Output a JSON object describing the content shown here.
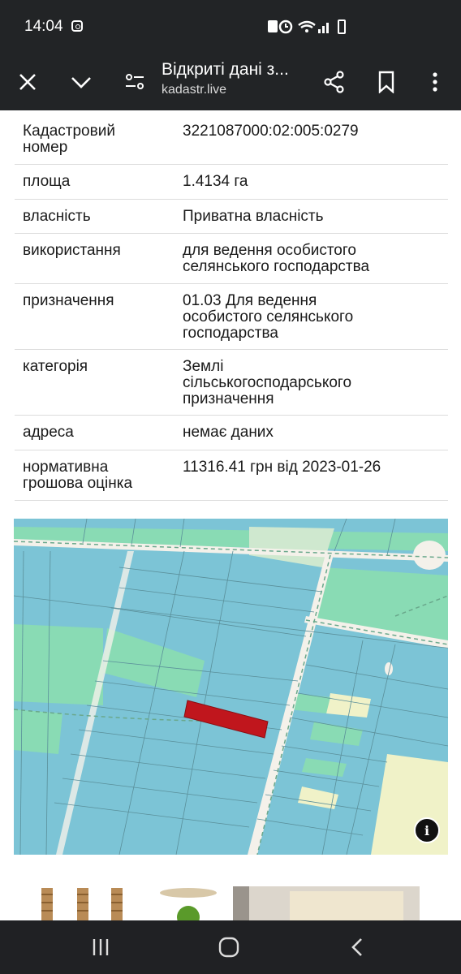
{
  "status_bar": {
    "time": "14:04",
    "icons": [
      "instagram-icon",
      "data-saver-icon",
      "alarm-icon",
      "wifi-icon",
      "signal-icon",
      "battery-icon"
    ]
  },
  "toolbar": {
    "title": "Відкриті дані з...",
    "url": "kadastr.live",
    "icons": [
      "close-icon",
      "chevron-down-icon",
      "settings-icon",
      "share-icon",
      "bookmark-icon",
      "more-icon"
    ]
  },
  "parcel": {
    "rows": [
      {
        "key": "Кадастровий\nномер",
        "value": "3221087000:02:005:0279"
      },
      {
        "key": "площа",
        "value": "1.4134 га"
      },
      {
        "key": "власність",
        "value": "Приватна власність"
      },
      {
        "key": "використання",
        "value": "для ведення особистого\nселянського господарства"
      },
      {
        "key": "призначення",
        "value": "01.03 Для ведення\nособистого селянського\nгосподарства"
      },
      {
        "key": "категорія",
        "value": "Землі\nсільськогосподарського\nпризначення"
      },
      {
        "key": "адреса",
        "value": "немає даних"
      },
      {
        "key": "нормативна\nгрошова оцінка",
        "value": "11316.41 грн від 2023-01-26"
      }
    ]
  },
  "map": {
    "colors": {
      "parcel": "#7cc4d6",
      "green": "#89dbb4",
      "cream": "#f0f2c8",
      "road": "#f4f1ea",
      "selected": "#c0161d",
      "line": "#5a8f9a"
    },
    "info_label": "i"
  },
  "nav": {
    "icons": [
      "recent-apps-icon",
      "home-icon",
      "back-icon"
    ]
  }
}
